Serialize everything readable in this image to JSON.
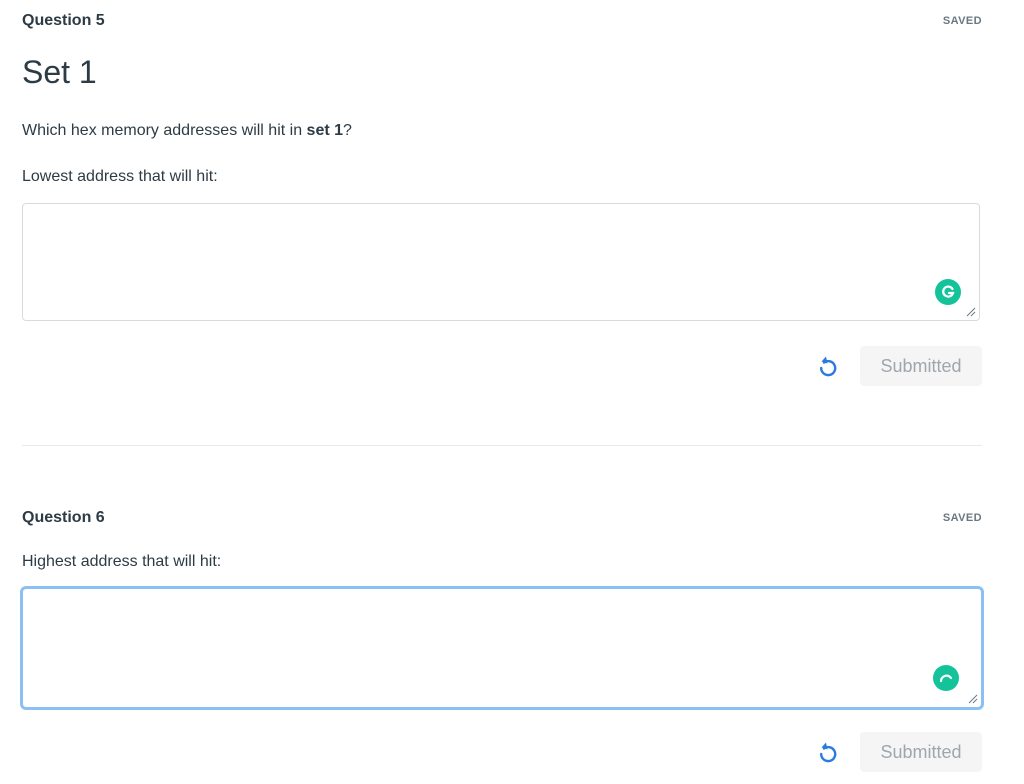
{
  "question5": {
    "title": "Question 5",
    "status": "SAVED",
    "set_title": "Set 1",
    "prompt_before": "Which hex memory addresses will hit in ",
    "prompt_bold": "set 1",
    "prompt_after": "?",
    "field_label": "Lowest address that will hit:",
    "answer_value": "",
    "submit_label": "Submitted"
  },
  "question6": {
    "title": "Question 6",
    "status": "SAVED",
    "field_label": "Highest address that will hit:",
    "answer_value": "",
    "submit_label": "Submitted"
  },
  "colors": {
    "grammarly": "#15c39a",
    "focus_ring": "#8cc0f5",
    "undo_icon": "#2b7ae0",
    "submitted_text": "#a0a6ab"
  },
  "icons": {
    "undo": "undo-icon",
    "grammarly": "grammarly-icon",
    "grammarly_loading": "grammarly-loading-icon",
    "resize": "resize-grip-icon"
  }
}
